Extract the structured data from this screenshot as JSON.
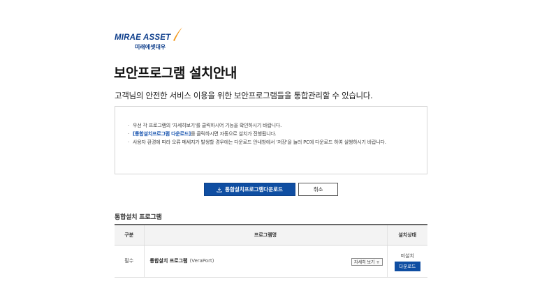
{
  "logo": {
    "english": "MIRAE ASSET",
    "korean": "미래에셋대우"
  },
  "page_title": "보안프로그램 설치안내",
  "intro": "고객님의 안전한 서비스 이용을 위한 보안프로그램들을 통합관리할 수 있습니다.",
  "notices": {
    "item1": "우선 각 프로그램의 '자세히보기'를 클릭하시어 기능을 확인하시기 바랍니다.",
    "item2_highlight": "[통합설치프로그램 다운로드]",
    "item2_rest": "를 클릭하시면 자동으로 설치가 진행됩니다.",
    "item3": "사용자 환경에 따라 오류 메세지가 발생할 경우에는 다운로드 안내창에서 '저장'을 눌러 PC에 다운로드 하여 실행하시기 바랍니다."
  },
  "buttons": {
    "download_all": "통합설치프로그램다운로드",
    "cancel": "취소"
  },
  "section_title": "통합설치 프로그램",
  "table": {
    "headers": {
      "type": "구분",
      "name": "프로그램명",
      "status": "설치상태"
    },
    "rows": [
      {
        "type": "필수",
        "name": "통합설치 프로그램",
        "vendor": "(VeraPort)",
        "detail_label": "자세히 보기 +",
        "status": "미설치",
        "action_label": "다운로드"
      }
    ]
  },
  "colors": {
    "brand_blue": "#0f4ea2",
    "logo_orange": "#f39a1e"
  },
  "icons": {
    "download": "download-icon",
    "logo_swoosh": "swoosh-icon"
  }
}
